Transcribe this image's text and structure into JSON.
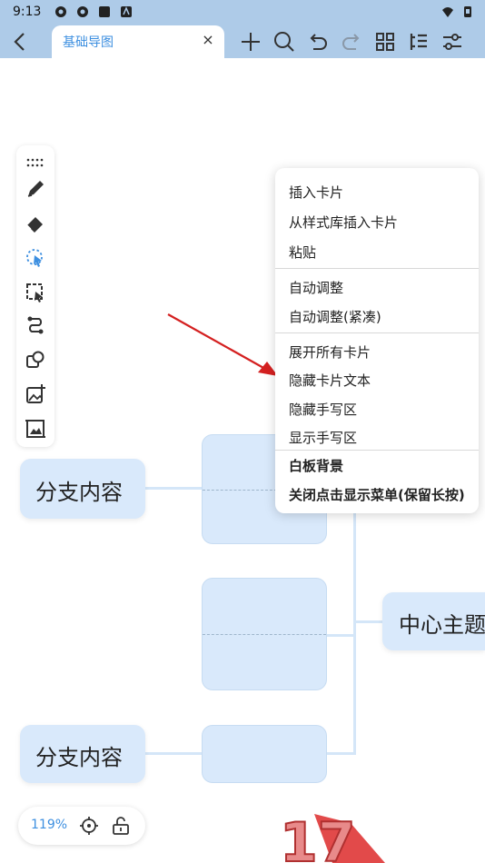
{
  "status_bar": {
    "time": "9:13"
  },
  "toolbar": {
    "tab_title": "基础导图",
    "close_glyph": "×",
    "buttons": [
      "back-icon",
      "plus-icon",
      "search-icon",
      "undo-icon",
      "redo-icon",
      "grid-icon",
      "outline-icon",
      "settings-icon"
    ]
  },
  "palette": {
    "tools": [
      "drag-handle-icon",
      "pen-icon",
      "eraser-icon",
      "lasso-select-icon",
      "area-select-icon",
      "connector-icon",
      "shape-icon",
      "insert-image-icon",
      "image-frame-icon"
    ]
  },
  "mindmap": {
    "center_topic": "中心主题",
    "branch_top": "分支内容",
    "branch_bottom": "分支内容"
  },
  "context_menu": {
    "items": [
      "插入卡片",
      "从样式库插入卡片",
      "粘贴",
      "自动调整",
      "自动调整(紧凑)",
      "展开所有卡片",
      "隐藏卡片文本",
      "隐藏手写区",
      "显示手写区",
      "白板背景",
      "关闭点击显示菜单(保留长按)"
    ]
  },
  "zoom": {
    "level": "119%"
  },
  "watermark": {
    "text": "17"
  },
  "colors": {
    "accent": "#3d8fe0",
    "header": "#aecbe8",
    "node_fill": "#d9e9fb",
    "arrow": "#d42020"
  }
}
